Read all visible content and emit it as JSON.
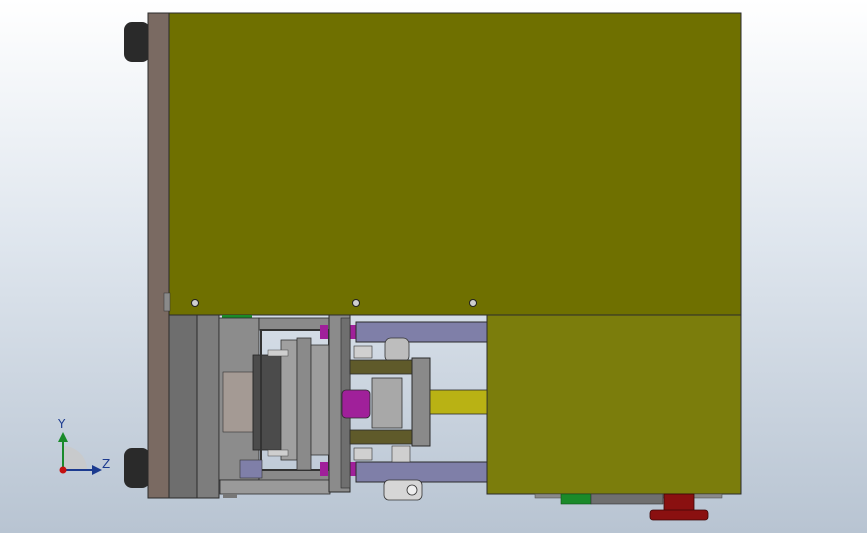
{
  "viewport": {
    "background_top": "#ffffff",
    "background_bottom": "#b8c4d2"
  },
  "colors": {
    "olive_body": "#6f7000",
    "olive_lower": "#7b7d0c",
    "plate_brown": "#7a6a62",
    "plate_gray": "#7d7d7d",
    "dark_gray": "#555555",
    "rod_blue": "#7f7fa8",
    "magenta": "#a0209a",
    "yellow_cyl": "#b9b214",
    "green_strip": "#1a8a2a",
    "red_pedal": "#8a1010"
  },
  "triad": {
    "y_label": "Y",
    "z_label": "Z"
  }
}
